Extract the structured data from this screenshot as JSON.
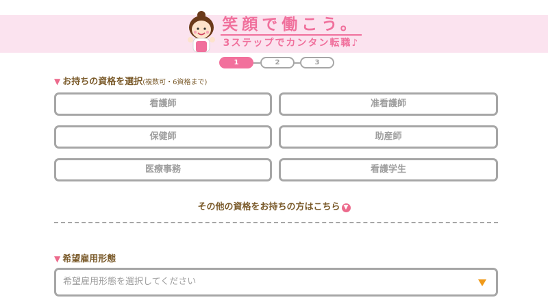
{
  "header": {
    "title": "笑顔で働こう。",
    "subtitle": "3ステップでカンタン転職♪"
  },
  "steps": [
    "1",
    "2",
    "3"
  ],
  "qualifications": {
    "label": "お持ちの資格を選択",
    "note": "(複数可・6資格まで)",
    "options": [
      "看護師",
      "准看護師",
      "保健師",
      "助産師",
      "医療事務",
      "看護学生"
    ],
    "more_link": "その他の資格をお持ちの方はこちら"
  },
  "employment": {
    "label": "希望雇用形態",
    "placeholder": "希望雇用形態を選択してください"
  },
  "colors": {
    "accent": "#f0709c",
    "brand_bg": "#fbe3ef",
    "border": "#a6a6a6",
    "arrow": "#f09a1a"
  },
  "icons": [
    "mascot-icon",
    "triangle-down-icon",
    "circle-arrow-down-icon",
    "dropdown-arrow-icon"
  ]
}
